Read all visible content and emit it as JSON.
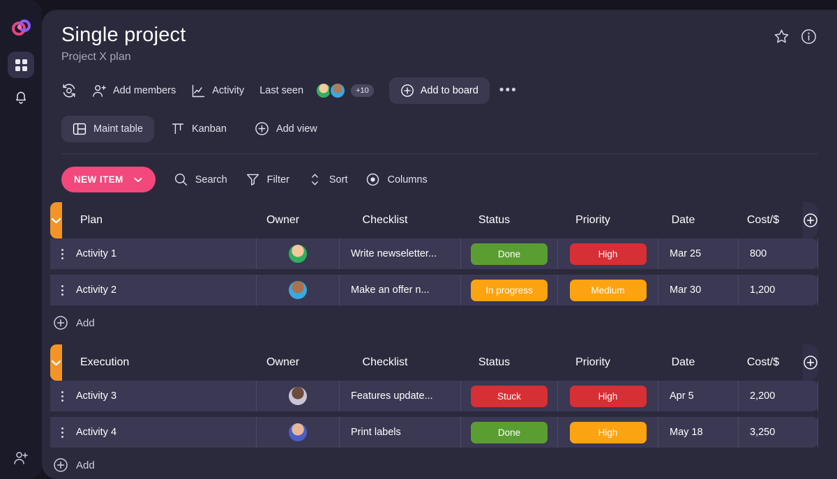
{
  "sidebar": {
    "logo_name": "app-logo",
    "items": [
      {
        "icon": "grid-icon",
        "label": "Boards",
        "active": true
      },
      {
        "icon": "bell-icon",
        "label": "Notifications",
        "active": false
      }
    ],
    "bottom_item": {
      "icon": "add-person-icon",
      "label": "Invite"
    }
  },
  "header": {
    "title": "Single project",
    "subtitle": "Project X plan",
    "star_icon": "star-icon",
    "info_icon": "info-icon"
  },
  "meta": {
    "refresh_icon": "refresh-history-icon",
    "add_members_icon": "add-person-icon",
    "add_members_label": "Add members",
    "activity_icon": "activity-chart-icon",
    "activity_label": "Activity",
    "last_seen_label": "Last seen",
    "avatar_overflow": "+10",
    "add_to_board_icon": "plus-circle-icon",
    "add_to_board_label": "Add to board",
    "more_label": "•••"
  },
  "views": [
    {
      "icon": "table-layout-icon",
      "label": "Maint table",
      "active": true
    },
    {
      "icon": "kanban-icon",
      "label": "Kanban",
      "active": false
    },
    {
      "icon": "plus-circle-icon",
      "label": "Add view",
      "active": false
    }
  ],
  "actions": {
    "new_item_label": "NEW ITEM",
    "new_item_chevron": "chevron-down-icon",
    "search_icon": "search-icon",
    "search_label": "Search",
    "filter_icon": "filter-icon",
    "filter_label": "Filter",
    "sort_icon": "sort-icon",
    "sort_label": "Sort",
    "columns_icon": "eye-icon",
    "columns_label": "Columns"
  },
  "colors": {
    "accent_pink": "#f2487c",
    "group_orange": "#f59426",
    "status_done": "#5a9e32",
    "status_in_progress": "#fca311",
    "status_stuck": "#d62f35",
    "priority_high_red": "#d62f35",
    "priority_medium": "#fca311",
    "priority_high_orange": "#fca311",
    "card_bg": "#2b2a3d",
    "row_bg": "#3a3852",
    "page_bg": "#15141f"
  },
  "table": {
    "columns": [
      "Owner",
      "Checklist",
      "Status",
      "Priority",
      "Date",
      "Cost/$"
    ],
    "add_label": "Add",
    "groups": [
      {
        "name": "Plan",
        "toggle_icon": "chevron-down-icon",
        "add_column_icon": "plus-circle-icon",
        "rows": [
          {
            "name": "Activity 1",
            "owner_avatar": "avatar-1",
            "checklist": "Write newseletter...",
            "status": "Done",
            "status_color": "#5a9e32",
            "priority": "High",
            "priority_color": "#d62f35",
            "date": "Mar 25",
            "cost": "800"
          },
          {
            "name": "Activity 2",
            "owner_avatar": "avatar-2",
            "checklist": "Make an offer n...",
            "status": "In progress",
            "status_color": "#fca311",
            "priority": "Medium",
            "priority_color": "#fca311",
            "date": "Mar 30",
            "cost": "1,200"
          }
        ]
      },
      {
        "name": "Execution",
        "toggle_icon": "chevron-down-icon",
        "add_column_icon": "plus-circle-icon",
        "rows": [
          {
            "name": "Activity 3",
            "owner_avatar": "avatar-3",
            "checklist": "Features update...",
            "status": "Stuck",
            "status_color": "#d62f35",
            "priority": "High",
            "priority_color": "#d62f35",
            "date": "Apr 5",
            "cost": "2,200"
          },
          {
            "name": "Activity 4",
            "owner_avatar": "avatar-4",
            "checklist": "Print labels",
            "status": "Done",
            "status_color": "#5a9e32",
            "priority": "High",
            "priority_color": "#fca311",
            "date": "May 18",
            "cost": "3,250"
          }
        ]
      }
    ]
  }
}
